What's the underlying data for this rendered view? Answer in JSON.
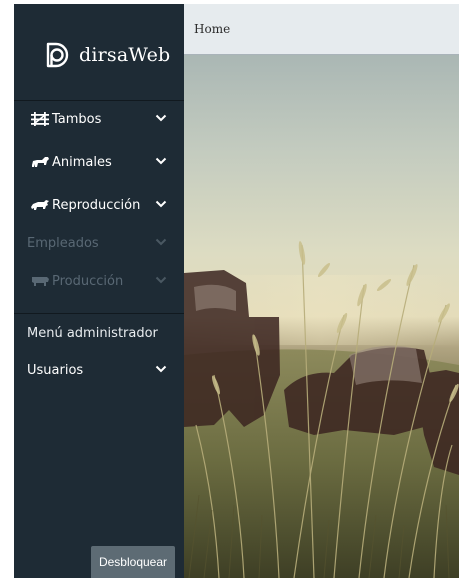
{
  "brand": {
    "name": "dirsaWeb",
    "logo_icon": "dirsa-logo-icon"
  },
  "sidebar": {
    "items": [
      {
        "label": "Tambos",
        "icon": "barn-icon",
        "enabled": true
      },
      {
        "label": "Animales",
        "icon": "cow-icon",
        "enabled": true
      },
      {
        "label": "Reproducción",
        "icon": "bull-icon",
        "enabled": true
      },
      {
        "label": "Empleados",
        "icon": "",
        "enabled": false
      },
      {
        "label": "Producción",
        "icon": "dairy-cow-icon",
        "enabled": false
      }
    ],
    "admin_header": "Menú administrador",
    "admin_items": [
      {
        "label": "Usuarios",
        "icon": "",
        "enabled": true
      }
    ],
    "unlock_button": "Desbloquear"
  },
  "header": {
    "breadcrumb": "Home"
  },
  "hero": {
    "image": "grass-field-cows-photo"
  },
  "colors": {
    "sidebar_bg": "#1e2b35",
    "topbar_bg": "#e6ebee",
    "disabled_text": "#596874",
    "button_bg": "#5d6b74"
  }
}
